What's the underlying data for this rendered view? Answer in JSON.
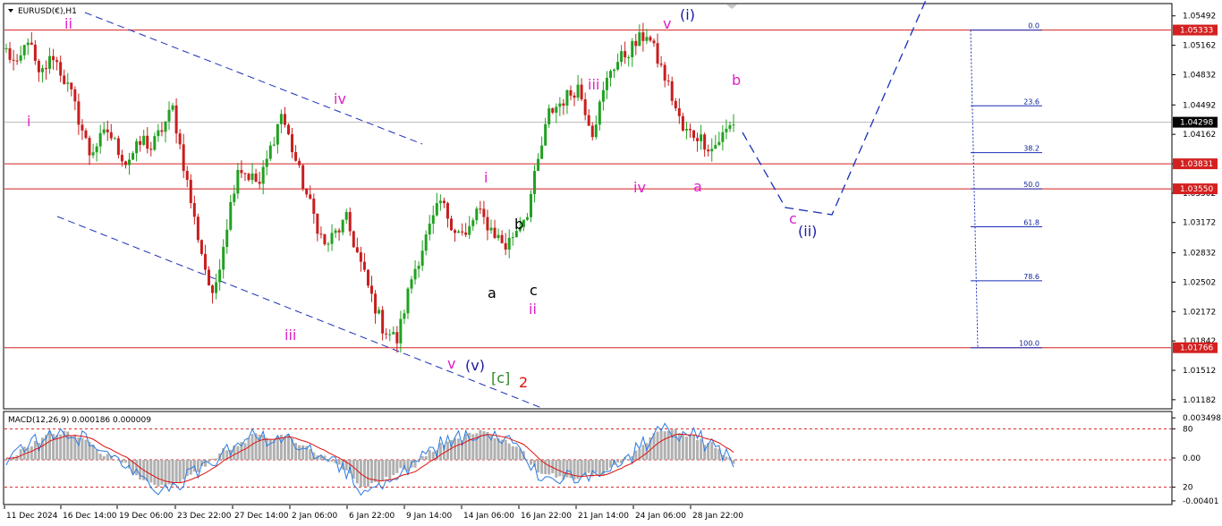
{
  "symbol_title": "EURUSD(€),H1",
  "macd_title": "MACD(12,26,9) 0.000186 0.000009",
  "colors": {
    "bull": "#21a121",
    "bear": "#c81e1e",
    "level_line": "#d42020",
    "trend_line": "#1a2fb8",
    "wave_magenta": "#e020c8",
    "wave_navy": "#1a1aa0",
    "wave_black": "#000000",
    "wave_green": "#2a8a2a",
    "wave_red": "#e01010",
    "macd_hist": "#b0b0b0",
    "macd_line": "#2a7be0",
    "signal_line": "#e01010",
    "price_box_red": "#d42020",
    "price_box_black": "#000000"
  },
  "chart_data": [
    {
      "type": "line",
      "title": "EURUSD(€),H1",
      "y_axis_ticks": [
        "1.05492",
        "1.05162",
        "1.04832",
        "1.04492",
        "1.04162",
        "1.03832",
        "1.03502",
        "1.03172",
        "1.02832",
        "1.02502",
        "1.02172",
        "1.01842",
        "1.01512",
        "1.01182"
      ],
      "x_axis_ticks": [
        "11 Dec 2024",
        "16 Dec 14:00",
        "19 Dec 06:00",
        "23 Dec 22:00",
        "27 Dec 14:00",
        "2 Jan 06:00",
        "6 Jan 22:00",
        "9 Jan 14:00",
        "14 Jan 06:00",
        "16 Jan 22:00",
        "21 Jan 14:00",
        "24 Jan 06:00",
        "28 Jan 22:00"
      ],
      "ylim": [
        1.0108,
        1.0563
      ],
      "horizontal_levels": [
        {
          "price": 1.05333,
          "label": "1.05333"
        },
        {
          "price": 1.03831,
          "label": "1.03831"
        },
        {
          "price": 1.0355,
          "label": "1.03550"
        },
        {
          "price": 1.01766,
          "label": "1.01766"
        }
      ],
      "current_price": {
        "price": 1.04298,
        "label": "1.04298"
      },
      "price_path": {
        "x_index": [
          0,
          3,
          6,
          9,
          13,
          18,
          23,
          28,
          33,
          38,
          40,
          46,
          52,
          57,
          64,
          70,
          76,
          82,
          88,
          94,
          100,
          104,
          108,
          112,
          116,
          120,
          124,
          127,
          130,
          133,
          138,
          144,
          150,
          158,
          162,
          167,
          172,
          177,
          183,
          187,
          191,
          195,
          201
        ],
        "close": [
          1.051,
          1.049,
          1.0525,
          1.048,
          1.0505,
          1.046,
          1.0395,
          1.042,
          1.0385,
          1.041,
          1.04,
          1.0445,
          1.032,
          1.023,
          1.038,
          1.036,
          1.044,
          1.036,
          1.029,
          1.032,
          1.0245,
          1.02,
          1.0185,
          1.0255,
          1.03,
          1.034,
          1.031,
          1.03,
          1.033,
          1.0315,
          1.029,
          1.033,
          1.044,
          1.047,
          1.042,
          1.049,
          1.051,
          1.053,
          1.047,
          1.042,
          1.0415,
          1.04,
          1.043
        ]
      },
      "projection_path": [
        [
          830,
          148
        ],
        [
          878,
          232
        ],
        [
          930,
          240
        ],
        [
          1035,
          0
        ]
      ],
      "fibonacci": [
        {
          "level": "0.0",
          "price": 1.05333
        },
        {
          "level": "23.6",
          "price": 1.04482
        },
        {
          "level": "38.2",
          "price": 1.03956
        },
        {
          "level": "50.0",
          "price": 1.0355
        },
        {
          "level": "61.8",
          "price": 1.03124
        },
        {
          "level": "78.6",
          "price": 1.02518
        },
        {
          "level": "100.0",
          "price": 1.01766
        }
      ]
    },
    {
      "type": "bar",
      "title": "MACD(12,26,9) 0.000186 0.000009",
      "y_axis_ticks": [
        "0.003498",
        "80",
        "0.00",
        "20",
        "-0.00401"
      ],
      "levels": [
        80,
        50,
        20
      ]
    }
  ],
  "wave_labels": [
    {
      "text": "ii",
      "color": "wave_magenta"
    },
    {
      "text": "i",
      "color": "wave_magenta"
    },
    {
      "text": "iv",
      "color": "wave_magenta"
    },
    {
      "text": "iii",
      "color": "wave_magenta"
    },
    {
      "text": "v",
      "color": "wave_magenta"
    },
    {
      "text": "(v)",
      "color": "wave_navy"
    },
    {
      "text": "[c]",
      "color": "wave_green"
    },
    {
      "text": "2",
      "color": "wave_red"
    },
    {
      "text": "i",
      "color": "wave_magenta"
    },
    {
      "text": "a",
      "color": "wave_black"
    },
    {
      "text": "b",
      "color": "wave_black"
    },
    {
      "text": "c",
      "color": "wave_black"
    },
    {
      "text": "ii",
      "color": "wave_magenta"
    },
    {
      "text": "iii",
      "color": "wave_magenta"
    },
    {
      "text": "iv",
      "color": "wave_magenta"
    },
    {
      "text": "v",
      "color": "wave_magenta"
    },
    {
      "text": "(i)",
      "color": "wave_navy"
    },
    {
      "text": "a",
      "color": "wave_magenta"
    },
    {
      "text": "b",
      "color": "wave_magenta"
    },
    {
      "text": "c",
      "color": "wave_magenta"
    },
    {
      "text": "(ii)",
      "color": "wave_navy"
    }
  ]
}
